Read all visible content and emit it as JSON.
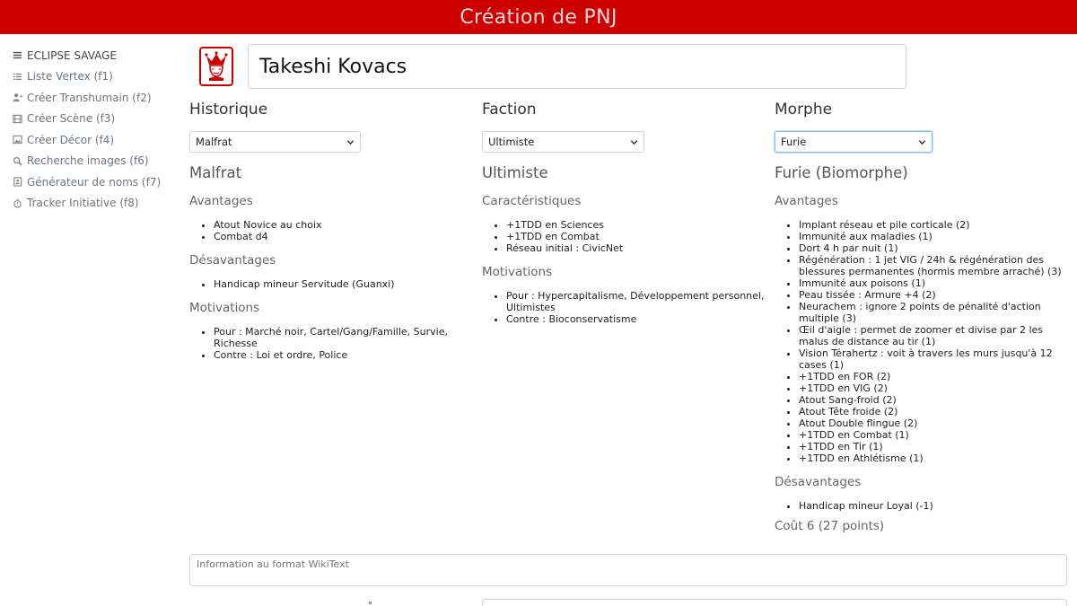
{
  "header": {
    "title": "Création de PNJ"
  },
  "sidebar": {
    "items": [
      {
        "label": "ECLIPSE SAVAGE",
        "icon": "menu-icon"
      },
      {
        "label": "Liste Vertex (f1)",
        "icon": "list-icon"
      },
      {
        "label": "Créer Transhumain (f2)",
        "icon": "user-plus-icon"
      },
      {
        "label": "Créer Scène (f3)",
        "icon": "film-icon"
      },
      {
        "label": "Créer Décor (f4)",
        "icon": "image-icon"
      },
      {
        "label": "Recherche images (f6)",
        "icon": "search-icon"
      },
      {
        "label": "Générateur de noms (f7)",
        "icon": "address-book-icon"
      },
      {
        "label": "Tracker Initiative (f8)",
        "icon": "stopwatch-icon"
      }
    ]
  },
  "character": {
    "name": "Takeshi Kovacs",
    "logo_icon": "jester-icon",
    "accent": "#cc0000"
  },
  "historique": {
    "heading": "Historique",
    "selected": "Malfrat",
    "title": "Malfrat",
    "avantages_heading": "Avantages",
    "avantages": [
      "Atout Novice au choix",
      "Combat d4"
    ],
    "desavantages_heading": "Désavantages",
    "desavantages": [
      "Handicap mineur Servitude (Guanxi)"
    ],
    "motivations_heading": "Motivations",
    "motivations": [
      "Pour : Marché noir, Cartel/Gang/Famille, Survie, Richesse",
      "Contre : Loi et ordre, Police"
    ]
  },
  "faction": {
    "heading": "Faction",
    "selected": "Ultimiste",
    "title": "Ultimiste",
    "caracteristiques_heading": "Caractéristiques",
    "caracteristiques": [
      "+1TDD en Sciences",
      "+1TDD en Combat",
      "Réseau initial : CivicNet"
    ],
    "motivations_heading": "Motivations",
    "motivations": [
      "Pour : Hypercapitalisme, Développement personnel, Ultimistes",
      "Contre : Bioconservatisme"
    ]
  },
  "morphe": {
    "heading": "Morphe",
    "selected": "Furie",
    "title": "Furie (Biomorphe)",
    "avantages_heading": "Avantages",
    "avantages": [
      "Implant réseau et pile corticale (2)",
      "Immunité aux maladies (1)",
      "Dort 4 h par nuit (1)",
      "Régénération : 1 jet VIG / 24h & régénération des blessures permanentes (hormis membre arraché) (3)",
      "Immunité aux poisons (1)",
      "Peau tissée : Armure +4 (2)",
      "Neurachem : ignore 2 points de pénalité d'action multiple (3)",
      "Œil d'aigle : permet de zoomer et divise par 2 les malus de distance au tir (1)",
      "Vision Térahertz : voit à travers les murs jusqu'à 12 cases (1)",
      "+1TDD en FOR (2)",
      "+1TDD en VIG (2)",
      "Atout Sang-froid (2)",
      "Atout Tête froide (2)",
      "Atout Double flingue (2)",
      "+1TDD en Combat (1)",
      "+1TDD en Tir (1)",
      "+1TDD en Athlétisme (1)"
    ],
    "desavantages_heading": "Désavantages",
    "desavantages": [
      "Handicap mineur Loyal (-1)"
    ],
    "cout": "Coût 6 (27 points)"
  },
  "wikitext": {
    "placeholder": "Information au format WikiText"
  }
}
